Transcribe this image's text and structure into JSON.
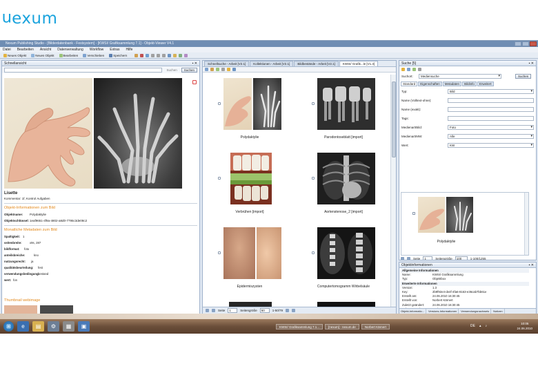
{
  "logo": {
    "text_rot": "n",
    "text_rest": "exum"
  },
  "window": {
    "title": "Nexum Publishing Studio - [Bilderdatenbank - Festsystem] - [KWSI/ Grafiksammlung 7.1] - Objekt-Viewer V4.1",
    "menu": [
      "Datei",
      "Bearbeiten",
      "Ansicht",
      "Datenverwaltung",
      "Workflow",
      "Extras",
      "Hilfe"
    ],
    "toolbar": [
      "Neues Objekt",
      "Neues Objekt",
      "Bearbeiten",
      "Verschieben",
      "Speichern"
    ]
  },
  "left": {
    "header": "Schnellansicht",
    "search_placeholder": "Suchen",
    "search_button": "Suchen",
    "title": "Lisette",
    "subtitle": "Kommentar: 1f, Kontrol Aufgaben",
    "section1": "Objekt-Informationen zum Bild",
    "obj_name_k": "Objektname:",
    "obj_name_v": "Polydaktylie",
    "obj_key_k": "Objektschlüssel:",
    "obj_key_v": "1eaf9651-4f9a-4802-a8d0-7795c3de08c2",
    "section2": "Monatliche Metadaten zum Bild",
    "meta": [
      {
        "k": "Spaltigkeit:",
        "v": "1"
      },
      {
        "k": "seitenbreite:",
        "v": "x9s, 287"
      },
      {
        "k": "bildformat:",
        "v": "foto"
      },
      {
        "k": "anteilsbreiche:",
        "v": "kno"
      },
      {
        "k": "nutzungsrecht:",
        "v": "ja"
      },
      {
        "k": "qualitätsbeurteilung:",
        "v": "fest"
      },
      {
        "k": "verwendungsbedingung:",
        "v": "bestand"
      },
      {
        "k": "wert:",
        "v": "fon"
      }
    ],
    "section3": "Thumbnail webimage"
  },
  "center": {
    "tabs": [
      "Schnellsuche - Arbeit [V2.1]",
      "Kollektionen - Arbeit [V2.1]",
      "Bildbestände - Arbeit [V2.1]",
      "KWSI/ Grafik...le [V1.3]"
    ],
    "items": [
      "Polydaktylie",
      "Parodontoseblatt [import]",
      "Verbrühen [import]",
      "Aortenstenose_2 [import]",
      "Epidermiszysten",
      "Computertomogramm Wirbelsäule",
      "",
      ""
    ],
    "pager": {
      "page_label": "Seite",
      "page": "1",
      "size_label": "Seitengröße",
      "size": "50",
      "range": "1-50/79"
    }
  },
  "right_top": {
    "header": "Suche [5]",
    "scope_label": "Suchort:",
    "scope_value": "Mediensuche",
    "search_button": "Suchen",
    "tabs": [
      "Standard",
      "Eigenschaften",
      "Metadaten",
      "Bildinfo",
      "Erweitert"
    ],
    "fields": [
      {
        "k": "Typ:",
        "v": "Bild",
        "sel": true
      },
      {
        "k": "Name (Volltext-ohne):",
        "v": "",
        "sel": false
      },
      {
        "k": "Name (exakt):",
        "v": "",
        "sel": false
      },
      {
        "k": "Tags:",
        "v": "",
        "sel": false
      },
      {
        "k": "Medienart/Bild:",
        "v": "Foto",
        "sel": true
      },
      {
        "k": "Medienart/MW:",
        "v": "Alle",
        "sel": true
      },
      {
        "k": "Wert:",
        "v": "KW",
        "sel": true
      }
    ],
    "result_caption": "Polydaktylie",
    "pager": {
      "page_label": "Seite",
      "page": "1",
      "size_label": "Seitengröße",
      "size": "100",
      "range": "1-100/1255"
    }
  },
  "right_bot": {
    "header": "Objektinformationen",
    "rows": [
      {
        "k": "Allgemeine Informationen",
        "v": "",
        "sect": true
      },
      {
        "k": "Name:",
        "v": "KWSI/ Grafiksammlung",
        "sect": false
      },
      {
        "k": "Typ:",
        "v": "Objektbox",
        "sect": false
      },
      {
        "k": "Erweiterte Informationen",
        "v": "",
        "sect": true
      },
      {
        "k": "Version:",
        "v": "1.3",
        "sect": false
      },
      {
        "k": "Key:",
        "v": "2b9f92e4-de4f-4fa6-8163-e36cab7bb61e",
        "sect": false
      },
      {
        "k": "Erstellt am:",
        "v": "24.06.2010 16:30:45",
        "sect": false
      },
      {
        "k": "Erstellt von:",
        "v": "Norbert Kärnert",
        "sect": false
      },
      {
        "k": "Zuletzt geändert:",
        "v": "24.06.2010 16:30:45",
        "sect": false
      },
      {
        "k": "Zuletzt geändert von:",
        "v": "Norbert Kärnert",
        "sect": false
      }
    ],
    "tabs": [
      "Objekt-Informatio...",
      "Versions-Informationen",
      "Verwendungsnachweis",
      "Notizen"
    ]
  },
  "taskbar": {
    "tasks": [
      "KWSI/ Grafiksammlung 7.1...",
      "[nexum] - nexum.de",
      "Norbert Kärnert"
    ],
    "time": "10:05",
    "date": "24.06.2010",
    "lang": "DE"
  }
}
